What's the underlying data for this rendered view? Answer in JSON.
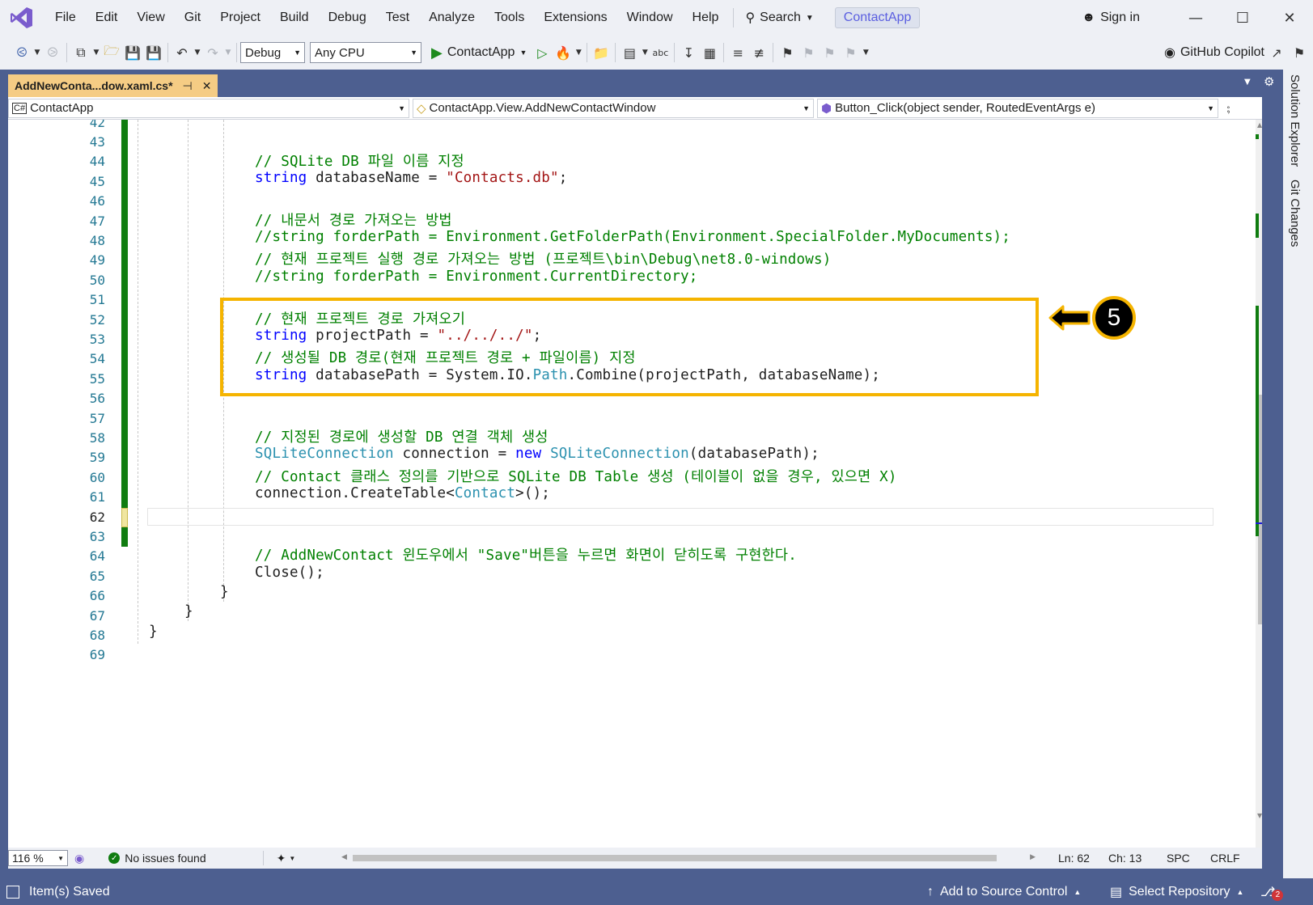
{
  "menu": [
    "File",
    "Edit",
    "View",
    "Git",
    "Project",
    "Build",
    "Debug",
    "Test",
    "Analyze",
    "Tools",
    "Extensions",
    "Window",
    "Help"
  ],
  "search_label": "Search",
  "project_name": "ContactApp",
  "sign_in": "Sign in",
  "toolbar": {
    "config": "Debug",
    "platform": "Any CPU",
    "run_label": "ContactApp",
    "copilot": "GitHub Copilot"
  },
  "side_tabs": [
    "Solution Explorer",
    "Git Changes"
  ],
  "doc_tab": {
    "label": "AddNewConta...dow.xaml.cs*"
  },
  "nav": {
    "project": "ContactApp",
    "class": "ContactApp.View.AddNewContactWindow",
    "member": "Button_Click(object sender, RoutedEventArgs e)"
  },
  "editor": {
    "line_numbers": [
      "42",
      "43",
      "44",
      "45",
      "46",
      "47",
      "48",
      "49",
      "50",
      "51",
      "52",
      "53",
      "54",
      "55",
      "56",
      "57",
      "58",
      "59",
      "60",
      "61",
      "62",
      "63",
      "64",
      "65",
      "66",
      "67",
      "68",
      "69"
    ],
    "current_line": "62",
    "code": {
      "l44": "// SQLite DB 파일 이름 지정",
      "l45_kw": "string",
      "l45_rest": " databaseName = ",
      "l45_str": "\"Contacts.db\"",
      "l45_end": ";",
      "l47": "// 내문서 경로 가져오는 방법",
      "l48": "//string forderPath = Environment.GetFolderPath(Environment.SpecialFolder.MyDocuments);",
      "l49": "// 현재 프로젝트 실행 경로 가져오는 방법 (프로젝트\\bin\\Debug\\net8.0-windows)",
      "l50": "//string forderPath = Environment.CurrentDirectory;",
      "l52": "// 현재 프로젝트 경로 가져오기",
      "l53_kw": "string",
      "l53_rest": " projectPath = ",
      "l53_str": "\"../../../\"",
      "l53_end": ";",
      "l54": "// 생성될 DB 경로(현재 프로젝트 경로 + 파일이름) 지정",
      "l55_kw": "string",
      "l55_rest": " databasePath = System.IO.",
      "l55_ty": "Path",
      "l55_end": ".Combine(projectPath, databaseName);",
      "l58": "// 지정된 경로에 생성할 DB 연결 객체 생성",
      "l59_ty": "SQLiteConnection",
      "l59_rest": " connection = ",
      "l59_kw": "new",
      "l59_sp": " ",
      "l59_ty2": "SQLiteConnection",
      "l59_end": "(databasePath);",
      "l60": "// Contact 클래스 정의를 기반으로 SQLite DB Table 생성 (테이블이 없을 경우, 있으면 X)",
      "l61_a": "connection.CreateTable<",
      "l61_ty": "Contact",
      "l61_b": ">();",
      "l64": "// AddNewContact 윈도우에서 \"Save\"버튼을 누르면 화면이 닫히도록 구현한다.",
      "l65": "Close();",
      "l66": "}",
      "l67": "}",
      "l68": "}"
    }
  },
  "callout_number": "5",
  "status": {
    "zoom": "116 %",
    "issues": "No issues found",
    "ln": "Ln: 62",
    "ch": "Ch: 13",
    "spc": "SPC",
    "crlf": "CRLF"
  },
  "bottom": {
    "saved": "Item(s) Saved",
    "source_control": "Add to Source Control",
    "repo": "Select Repository",
    "notif_count": "2"
  },
  "colors": {
    "accent": "#4d5f90",
    "tab_active": "#f5cc84",
    "highlight": "#f5b400"
  }
}
